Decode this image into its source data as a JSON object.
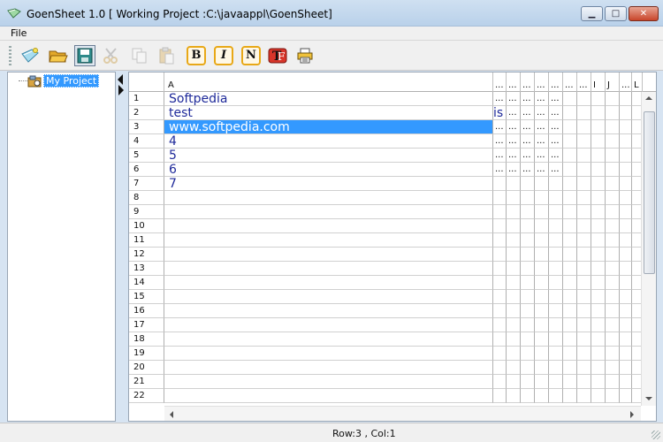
{
  "window": {
    "title": "GoenSheet 1.0 [ Working Project :C:\\javaappl\\GoenSheet]",
    "min_label": "▁",
    "max_label": "□",
    "close_label": "✕"
  },
  "menu": {
    "file": "File"
  },
  "toolbar": {
    "bold": "B",
    "italic": "I",
    "normal": "N"
  },
  "tree": {
    "root_label": "My Project"
  },
  "sheet": {
    "columns": [
      "A",
      "...",
      "...",
      "...",
      "...",
      "...",
      "...",
      "...",
      "I",
      "J",
      "...",
      "L"
    ],
    "rows": [
      {
        "num": "1",
        "a": "Softpedia",
        "b": "..."
      },
      {
        "num": "2",
        "a": "test",
        "b": "is"
      },
      {
        "num": "3",
        "a": "www.softpedia.com",
        "b": "..."
      },
      {
        "num": "4",
        "a": "4",
        "b": "..."
      },
      {
        "num": "5",
        "a": "5",
        "b": "..."
      },
      {
        "num": "6",
        "a": "6",
        "b": "..."
      },
      {
        "num": "7",
        "a": "7",
        "b": ""
      },
      {
        "num": "8",
        "a": "",
        "b": ""
      },
      {
        "num": "9",
        "a": "",
        "b": ""
      },
      {
        "num": "10",
        "a": "",
        "b": ""
      },
      {
        "num": "11",
        "a": "",
        "b": ""
      },
      {
        "num": "12",
        "a": "",
        "b": ""
      },
      {
        "num": "13",
        "a": "",
        "b": ""
      },
      {
        "num": "14",
        "a": "",
        "b": ""
      },
      {
        "num": "15",
        "a": "",
        "b": ""
      },
      {
        "num": "16",
        "a": "",
        "b": ""
      },
      {
        "num": "17",
        "a": "",
        "b": ""
      },
      {
        "num": "18",
        "a": "",
        "b": ""
      },
      {
        "num": "19",
        "a": "",
        "b": ""
      },
      {
        "num": "20",
        "a": "",
        "b": ""
      },
      {
        "num": "21",
        "a": "",
        "b": ""
      },
      {
        "num": "22",
        "a": "",
        "b": ""
      }
    ],
    "dotted_rows": 6,
    "selected_row": 3
  },
  "status": {
    "text": "Row:3 , Col:1"
  },
  "icons": [
    "app-icon",
    "new-icon",
    "open-icon",
    "save-icon",
    "cut-icon",
    "copy-icon",
    "paste-icon",
    "bold-icon",
    "italic-icon",
    "normal-icon",
    "font-icon",
    "print-icon",
    "project-icon"
  ],
  "colors": {
    "selection": "#3399ff",
    "cell_text": "#1f2a9a",
    "format_border": "#e8a817"
  }
}
